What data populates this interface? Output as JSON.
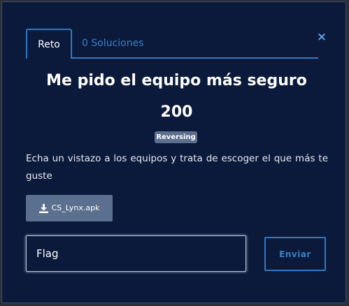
{
  "modal": {
    "close_label": "×",
    "tabs": [
      {
        "label": "Reto",
        "active": true
      },
      {
        "label": "0 Soluciones",
        "active": false
      }
    ],
    "challenge": {
      "title": "Me pido el equipo más seguro",
      "points": "200",
      "category": "Reversing",
      "description": "Echa un vistazo a los equipos y trata de escoger el que más te guste",
      "file_name": "CS_Lynx.apk",
      "file_icon": "download-icon"
    },
    "submission": {
      "placeholder": "Flag",
      "value": "",
      "submit_label": "Enviar"
    }
  },
  "colors": {
    "background": "#0b1a3a",
    "accent": "#2f78c4",
    "badge": "#5b6f8e",
    "text": "#ffffff"
  }
}
